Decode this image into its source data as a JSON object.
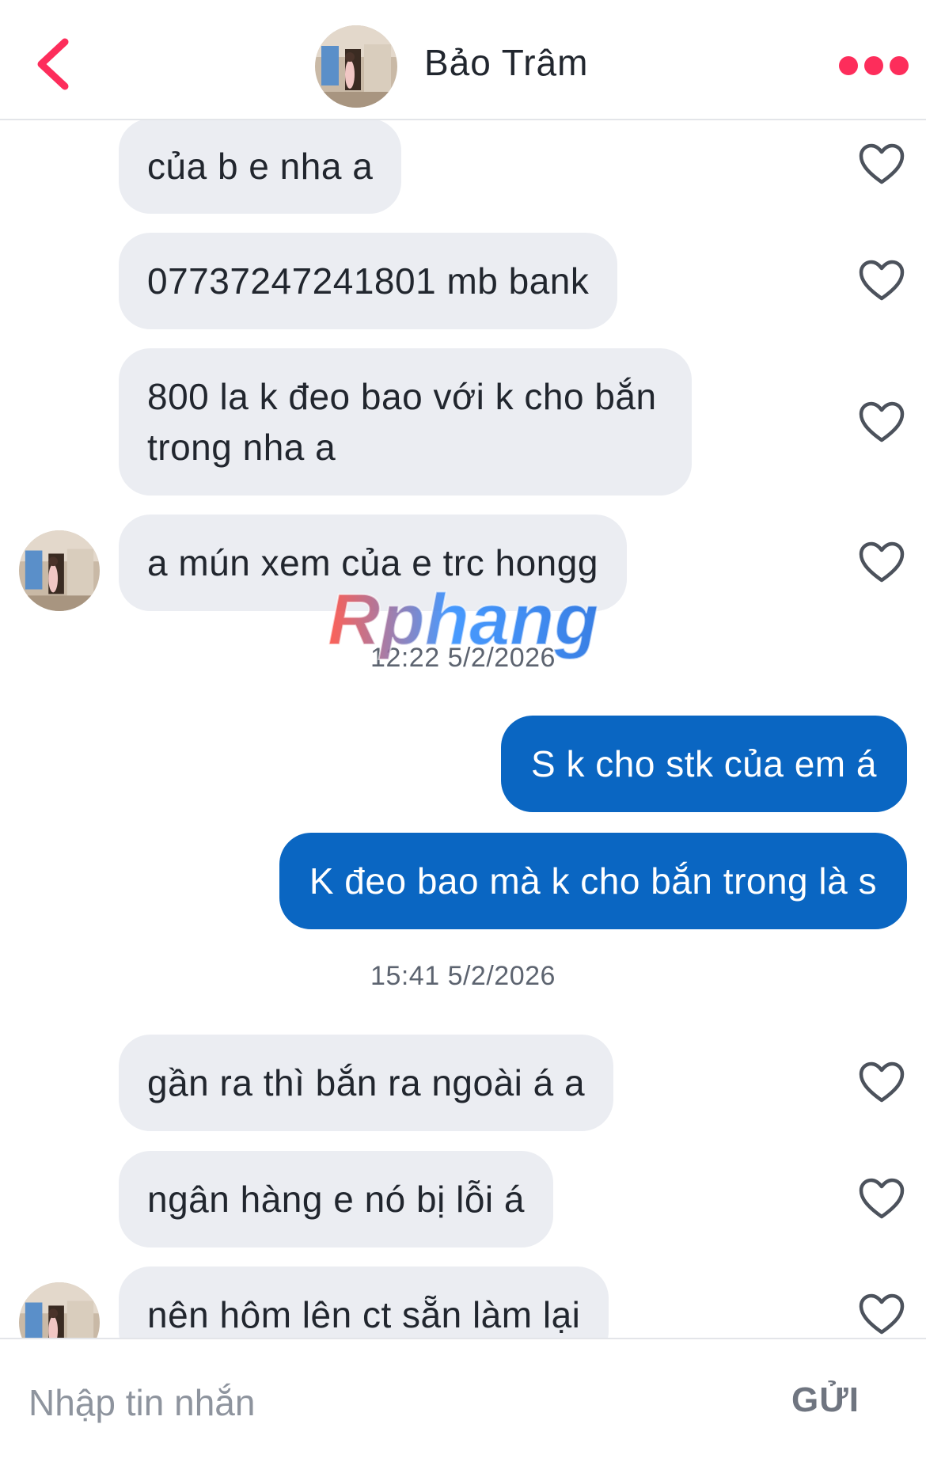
{
  "header": {
    "contact_name": "Bảo Trâm",
    "back_icon": "chevron-left-icon",
    "more_icon": "more-dots-icon",
    "accent_color": "#fd2d5b"
  },
  "messages": [
    {
      "direction": "in",
      "text": "của b e nha a",
      "liked": false
    },
    {
      "direction": "in",
      "text": "07737247241801 mb bank",
      "liked": false
    },
    {
      "direction": "in",
      "text": "800 la k đeo bao với k cho bắn trong nha a",
      "liked": false
    },
    {
      "direction": "in",
      "text": "a mún xem của e trc hongg",
      "liked": false
    },
    {
      "type": "timestamp",
      "text": "12:22 5/2/2026"
    },
    {
      "direction": "out",
      "text": "S k cho stk của em á"
    },
    {
      "direction": "out",
      "text": "K đeo bao mà k cho bắn trong là s"
    },
    {
      "type": "timestamp",
      "text": "15:41 5/2/2026"
    },
    {
      "direction": "in",
      "text": "gần ra thì bắn ra ngoài á a",
      "liked": false
    },
    {
      "direction": "in",
      "text": "ngân hàng e nó bị lỗi á",
      "liked": false
    },
    {
      "direction": "in",
      "text": "nên hôm lên ct sẵn làm lại",
      "liked": false
    }
  ],
  "composer": {
    "placeholder": "Nhập tin nhắn",
    "send_label": "GỬI"
  },
  "watermark": {
    "text": "Rphang"
  },
  "colors": {
    "incoming_bubble": "#ebedf2",
    "outgoing_bubble": "#0a66c2",
    "text": "#21262e",
    "timestamp": "#5d6470"
  }
}
